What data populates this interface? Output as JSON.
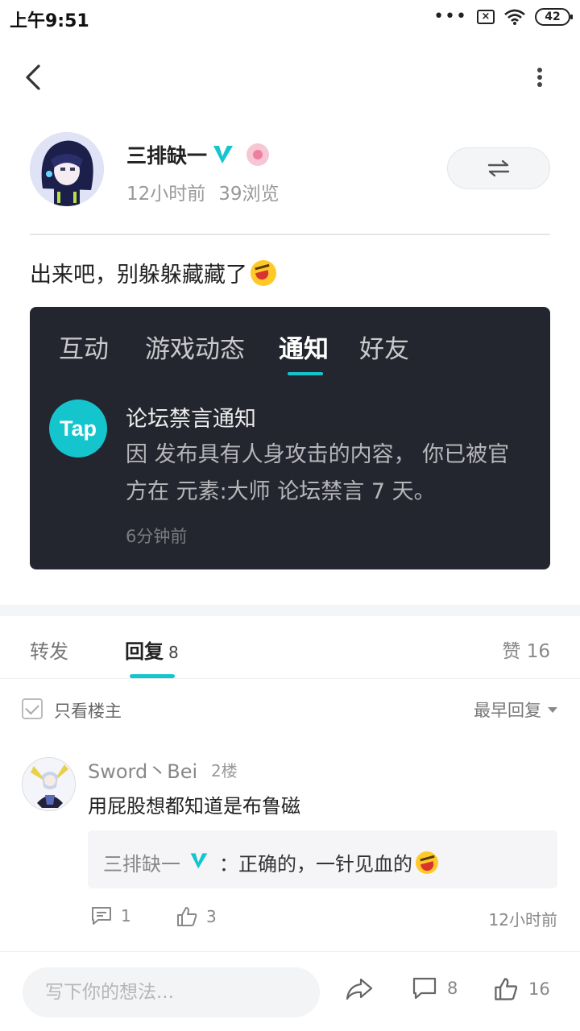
{
  "status_bar": {
    "time": "上午9:51",
    "dots": "•••",
    "sim": "×",
    "battery": "42"
  },
  "author": {
    "name": "三排缺一",
    "time_ago": "12小时前",
    "views": "39浏览"
  },
  "post": {
    "text": "出来吧，别躲躲藏藏了"
  },
  "screenshot": {
    "tabs": [
      "互动",
      "游戏动态",
      "通知",
      "好友"
    ],
    "active_tab": "通知",
    "logo_text": "Tap",
    "notice_title": "论坛禁言通知",
    "notice_body": "因 发布具有人身攻击的内容， 你已被官方在 元素:大师 论坛禁言 7 天。",
    "notice_time": "6分钟前"
  },
  "tabs": {
    "forward": "转发",
    "reply": "回复",
    "reply_count": "8",
    "like": "赞 16"
  },
  "filter": {
    "only_op": "只看楼主",
    "sort": "最早回复"
  },
  "comment": {
    "name": "Sword丶Bei",
    "floor": "2楼",
    "text": "用屁股想都知道是布鲁磁",
    "reply_name": "三排缺一",
    "reply_text": "：正确的，一针见血的",
    "reply_count": "1",
    "like_count": "3",
    "time": "12小时前"
  },
  "bottom_bar": {
    "placeholder": "写下你的想法...",
    "comment_count": "8",
    "like_count": "16"
  },
  "colors": {
    "accent": "#15c5ce",
    "card_bg": "#24262f"
  }
}
